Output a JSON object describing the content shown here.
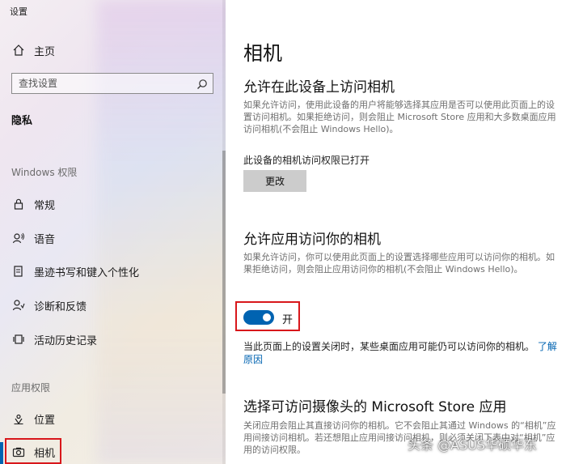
{
  "app": {
    "title": "设置"
  },
  "sidebar": {
    "home_label": "主页",
    "search_placeholder": "查找设置",
    "section_privacy": "隐私",
    "section_windows_permissions": "Windows 权限",
    "windows_items": [
      {
        "label": "常规",
        "icon": "lock-icon"
      },
      {
        "label": "语音",
        "icon": "speech-icon"
      },
      {
        "label": "墨迹书写和键入个性化",
        "icon": "handwriting-icon"
      },
      {
        "label": "诊断和反馈",
        "icon": "diagnostics-icon"
      },
      {
        "label": "活动历史记录",
        "icon": "activity-history-icon"
      }
    ],
    "section_app_permissions": "应用权限",
    "app_items": [
      {
        "label": "位置",
        "icon": "location-icon"
      },
      {
        "label": "相机",
        "icon": "camera-icon",
        "selected": true
      }
    ]
  },
  "main": {
    "title": "相机",
    "device_access": {
      "heading": "允许在此设备上访问相机",
      "description": "如果允许访问，使用此设备的用户将能够选择其应用是否可以使用此页面上的设置访问相机。如果拒绝访问，则会阻止 Microsoft Store 应用和大多数桌面应用访问相机(不会阻止 Windows Hello)。",
      "status": "此设备的相机访问权限已打开",
      "change_button": "更改"
    },
    "app_access": {
      "heading": "允许应用访问你的相机",
      "description": "如果允许访问，你可以使用此页面上的设置选择哪些应用可以访问你的相机。如果拒绝访问，则会阻止应用访问你的相机(不会阻止 Windows Hello)。",
      "toggle_state": "开",
      "toggle_on": true,
      "info": "当此页面上的设置关闭时，某些桌面应用可能仍可以访问你的相机。",
      "link": "了解原因"
    },
    "store_apps": {
      "heading": "选择可访问摄像头的 Microsoft Store 应用",
      "description": "关闭应用会阻止其直接访问你的相机。它不会阻止其通过 Windows 的“相机”应用间接访问相机。若还想阻止应用间接访问相机，则必须关闭下表中对“相机”应用的访问权限。"
    }
  },
  "watermark": "头条 @ASUS华硕华东",
  "colors": {
    "accent": "#0063b1",
    "highlight": "#d8171b"
  }
}
